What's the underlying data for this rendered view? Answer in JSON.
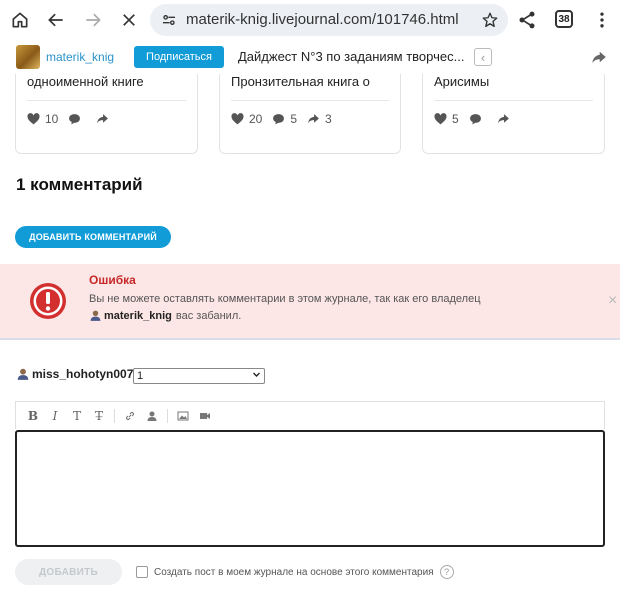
{
  "browser": {
    "url": "materik-knig.livejournal.com/101746.html",
    "tabs_count": "38",
    "icons": [
      "home-icon",
      "back-icon",
      "forward-icon",
      "stop-icon",
      "site-settings-icon",
      "bookmark-star-icon",
      "share-icon",
      "tabs-icon",
      "menu-icon"
    ]
  },
  "journal_strip": {
    "journal_name": "materik_knig",
    "subscribe_label": "Подписаться",
    "digest_title": "Дайджест N°3 по заданиям творчес...",
    "prev_label": "‹"
  },
  "related_posts": [
    {
      "title": "одноименной книге",
      "likes": "10",
      "comments": "",
      "reposts": ""
    },
    {
      "title": "Пронзительная книга о",
      "likes": "20",
      "comments": "5",
      "reposts": "3"
    },
    {
      "title": "Арисимы",
      "likes": "5",
      "comments": "",
      "reposts": ""
    }
  ],
  "comments": {
    "heading": "1 комментарий",
    "add_button": "ДОБАВИТЬ КОММЕНТАРИЙ"
  },
  "error": {
    "title": "Ошибка",
    "line1": "Вы не можете оставлять комментарии в этом журнале, так как его владелец",
    "owner": "materik_knig",
    "line2_suffix": "вас забанил.",
    "close": "×"
  },
  "form": {
    "author": "miss_hohotyn007",
    "userpic_value": "1",
    "toolbar": [
      "B",
      "I",
      "T",
      "T̶"
    ],
    "submit_label": "ДОБАВИТЬ",
    "repost_label": "Создать пост в моем журнале на основе этого комментария",
    "help": "?"
  },
  "colors": {
    "accent": "#119cd8",
    "link": "#2a92c9",
    "error_bg": "#fde6e6",
    "error_red": "#c62828"
  }
}
